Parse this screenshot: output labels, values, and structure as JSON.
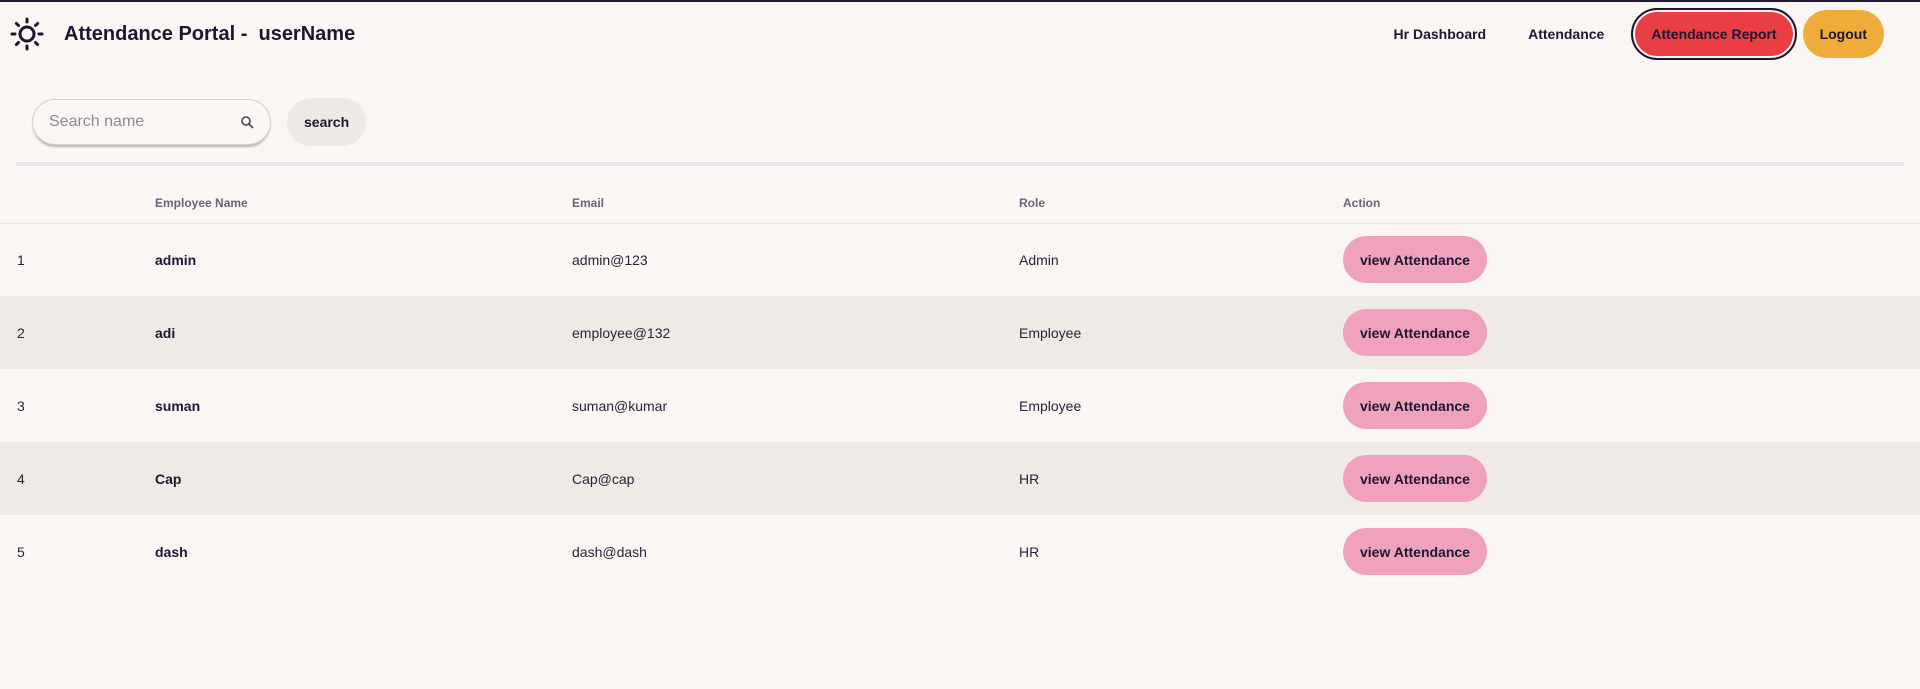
{
  "header": {
    "title": "Attendance Portal -  userName",
    "logo_icon": "sun-icon",
    "nav": {
      "hr_dashboard": "Hr Dashboard",
      "attendance": "Attendance",
      "attendance_report": "Attendance Report",
      "logout": "Logout"
    }
  },
  "search": {
    "placeholder": "Search name",
    "value": "",
    "button_label": "search"
  },
  "table": {
    "columns": [
      "",
      "Employee Name",
      "Email",
      "Role",
      "Action"
    ],
    "rows": [
      {
        "index": "1",
        "name": "admin",
        "email": "admin@123",
        "role": "Admin",
        "action": "view Attendance"
      },
      {
        "index": "2",
        "name": "adi",
        "email": "employee@132",
        "role": "Employee",
        "action": "view Attendance"
      },
      {
        "index": "3",
        "name": "suman",
        "email": "suman@kumar",
        "role": "Employee",
        "action": "view Attendance"
      },
      {
        "index": "4",
        "name": "Cap",
        "email": "Cap@cap",
        "role": "HR",
        "action": "view Attendance"
      },
      {
        "index": "5",
        "name": "dash",
        "email": "dash@dash",
        "role": "HR",
        "action": "view Attendance"
      }
    ]
  },
  "colors": {
    "background": "#faf6f3",
    "report_button": "#e83e44",
    "logout_button": "#efac3a",
    "view_button": "#f0a1bd",
    "alt_row": "#efeae6"
  }
}
